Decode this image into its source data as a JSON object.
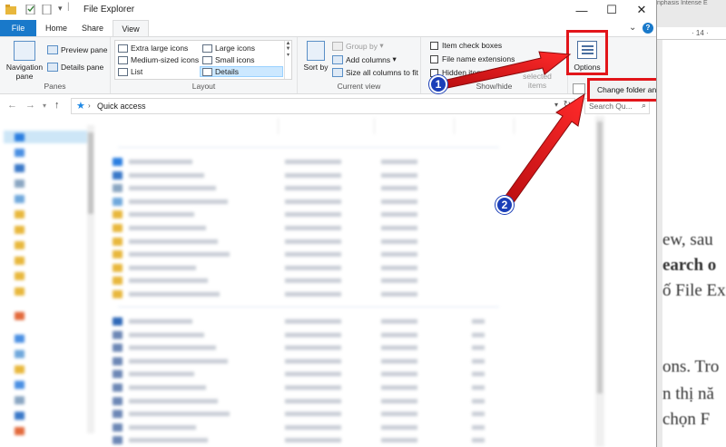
{
  "window": {
    "title": "File Explorer",
    "controls": {
      "minimize": "—",
      "maximize": "☐",
      "close": "✕"
    }
  },
  "tabs": [
    {
      "label": "File"
    },
    {
      "label": "Home"
    },
    {
      "label": "Share"
    },
    {
      "label": "View"
    }
  ],
  "ribbon": {
    "panes": {
      "label": "Panes",
      "navigation_pane": "Navigation pane",
      "preview_pane": "Preview pane",
      "details_pane": "Details pane"
    },
    "layout": {
      "label": "Layout",
      "items": [
        {
          "label": "Extra large icons"
        },
        {
          "label": "Large icons"
        },
        {
          "label": "Medium-sized icons"
        },
        {
          "label": "Small icons"
        },
        {
          "label": "List"
        },
        {
          "label": "Details"
        }
      ]
    },
    "current_view": {
      "label": "Current view",
      "sort_by": "Sort by",
      "group_by": "Group by",
      "add_columns": "Add columns",
      "size_all": "Size all columns to fit"
    },
    "show_hide": {
      "label": "Show/hide",
      "item_check_boxes": "Item check boxes",
      "file_name_extensions": "File name extensions",
      "hidden_items": "Hidden items",
      "hide_selected": "Hide selected items"
    },
    "options": {
      "label": "Options",
      "menu_item": "Change folder and search options"
    }
  },
  "address": {
    "path": "Quick access",
    "search_placeholder": "Search Qu..."
  },
  "annotations": {
    "step1": "1",
    "step2": "2",
    "color": "#e2151a",
    "badge_color": "#1b3fb8"
  },
  "background_doc": {
    "ruler": "· 14 ·",
    "top_text": "nphasis   Intense E",
    "lines": [
      "ew, sau",
      "earch o",
      "ố File Ex",
      "ons. Tro",
      "n thị nă",
      "chọn F"
    ]
  }
}
